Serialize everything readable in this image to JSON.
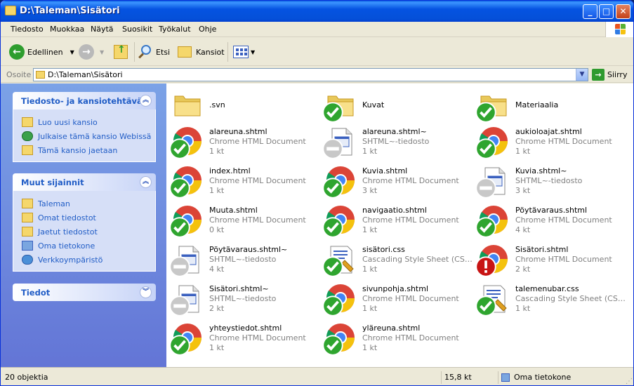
{
  "window": {
    "title": "D:\\Taleman\\Sisätori"
  },
  "menu": [
    "Tiedosto",
    "Muokkaa",
    "Näytä",
    "Suosikit",
    "Työkalut",
    "Ohje"
  ],
  "toolbar": {
    "back_label": "Edellinen",
    "search_label": "Etsi",
    "folders_label": "Kansiot"
  },
  "address": {
    "label": "Osoite",
    "value": "D:\\Taleman\\Sisätori",
    "go_label": "Siirry"
  },
  "sidebar": {
    "tasks": {
      "title": "Tiedosto- ja kansiotehtävät",
      "items": [
        "Luo uusi kansio",
        "Julkaise tämä kansio Webissä",
        "Tämä kansio jaetaan"
      ]
    },
    "places": {
      "title": "Muut sijainnit",
      "items": [
        "Taleman",
        "Omat tiedostot",
        "Jaetut tiedostot",
        "Oma tietokone",
        "Verkkoympäristö"
      ]
    },
    "details": {
      "title": "Tiedot"
    }
  },
  "files": [
    {
      "name": ".svn",
      "type": "",
      "size": "",
      "icon": "folder-icon",
      "badge": "none"
    },
    {
      "name": "Kuvat",
      "type": "",
      "size": "",
      "icon": "folder-icon",
      "badge": "ok"
    },
    {
      "name": "Materiaalia",
      "type": "",
      "size": "",
      "icon": "folder-icon",
      "badge": "ok"
    },
    {
      "name": "alareuna.shtml",
      "type": "Chrome HTML Document",
      "size": "1 kt",
      "icon": "chrome-icon",
      "badge": "ok"
    },
    {
      "name": "alareuna.shtml~",
      "type": "SHTML~-tiedosto",
      "size": "1 kt",
      "icon": "generic-file-icon",
      "badge": "unversioned"
    },
    {
      "name": "aukioloajat.shtml",
      "type": "Chrome HTML Document",
      "size": "1 kt",
      "icon": "chrome-icon",
      "badge": "ok"
    },
    {
      "name": "index.html",
      "type": "Chrome HTML Document",
      "size": "1 kt",
      "icon": "chrome-icon",
      "badge": "ok"
    },
    {
      "name": "Kuvia.shtml",
      "type": "Chrome HTML Document",
      "size": "3 kt",
      "icon": "chrome-icon",
      "badge": "ok"
    },
    {
      "name": "Kuvia.shtml~",
      "type": "SHTML~-tiedosto",
      "size": "3 kt",
      "icon": "generic-file-icon",
      "badge": "unversioned"
    },
    {
      "name": "Muuta.shtml",
      "type": "Chrome HTML Document",
      "size": "0 kt",
      "icon": "chrome-icon",
      "badge": "ok"
    },
    {
      "name": "navigaatio.shtml",
      "type": "Chrome HTML Document",
      "size": "1 kt",
      "icon": "chrome-icon",
      "badge": "ok"
    },
    {
      "name": "Pöytävaraus.shtml",
      "type": "Chrome HTML Document",
      "size": "4 kt",
      "icon": "chrome-icon",
      "badge": "ok"
    },
    {
      "name": "Pöytävaraus.shtml~",
      "type": "SHTML~-tiedosto",
      "size": "4 kt",
      "icon": "generic-file-icon",
      "badge": "unversioned"
    },
    {
      "name": "sisätori.css",
      "type": "Cascading Style Sheet (CSS) -...",
      "size": "1 kt",
      "icon": "css-file-icon",
      "badge": "ok"
    },
    {
      "name": "Sisätori.shtml",
      "type": "Chrome HTML Document",
      "size": "2 kt",
      "icon": "chrome-icon",
      "badge": "modified"
    },
    {
      "name": "Sisätori.shtml~",
      "type": "SHTML~-tiedosto",
      "size": "2 kt",
      "icon": "generic-file-icon",
      "badge": "unversioned"
    },
    {
      "name": "sivunpohja.shtml",
      "type": "Chrome HTML Document",
      "size": "1 kt",
      "icon": "chrome-icon",
      "badge": "ok"
    },
    {
      "name": "talemenubar.css",
      "type": "Cascading Style Sheet (CSS) -...",
      "size": "1 kt",
      "icon": "css-file-icon",
      "badge": "ok"
    },
    {
      "name": "yhteystiedot.shtml",
      "type": "Chrome HTML Document",
      "size": "1 kt",
      "icon": "chrome-icon",
      "badge": "ok"
    },
    {
      "name": "yläreuna.shtml",
      "type": "Chrome HTML Document",
      "size": "1 kt",
      "icon": "chrome-icon",
      "badge": "ok"
    }
  ],
  "status": {
    "count": "20 objektia",
    "size": "15,8 kt",
    "location": "Oma tietokone"
  }
}
